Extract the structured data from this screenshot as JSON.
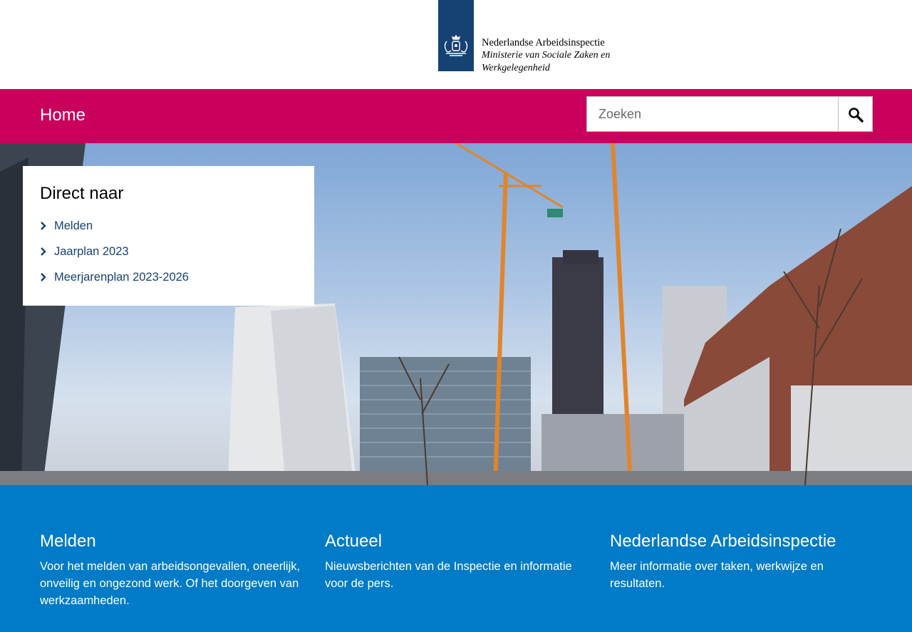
{
  "logo": {
    "organisation": "Nederlandse Arbeidsinspectie",
    "ministry": "Ministerie van Sociale Zaken en Werkgelegenheid",
    "icon": "coat-of-arms-icon",
    "brand_color": "#154273"
  },
  "nav": {
    "home_label": "Home",
    "bar_color": "#ca005d"
  },
  "search": {
    "placeholder": "Zoeken",
    "value": "",
    "button_icon": "search-icon"
  },
  "hero": {
    "image_subject": "construction-cranes-city-photo"
  },
  "direct_naar": {
    "title": "Direct naar",
    "items": [
      {
        "label": "Melden",
        "icon": "chevron-right-icon"
      },
      {
        "label": "Jaarplan 2023",
        "icon": "chevron-right-icon"
      },
      {
        "label": "Meerjarenplan 2023-2026",
        "icon": "chevron-right-icon"
      }
    ]
  },
  "cards": [
    {
      "title": "Melden",
      "text": "Voor het melden van arbeidsongevallen, oneerlijk, onveilig en ongezond werk. Of het doorgeven van werkzaamheden."
    },
    {
      "title": "Actueel",
      "text": "Nieuwsberichten van de Inspectie en informatie voor de pers."
    },
    {
      "title": "Nederlandse Arbeidsinspectie",
      "text": "Meer informatie over taken, werkwijze en resultaten."
    }
  ],
  "colors": {
    "footer": "#007bc7",
    "link": "#154273"
  }
}
